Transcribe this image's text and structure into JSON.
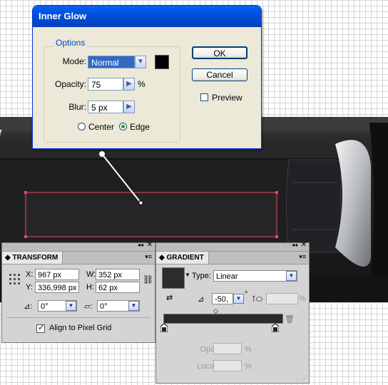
{
  "dialog": {
    "title": "Inner Glow",
    "group_label": "Options",
    "mode_label": "Mode:",
    "mode_value": "Normal",
    "glow_color": "#000000",
    "opacity_label": "Opacity:",
    "opacity_value": "75",
    "opacity_unit": "%",
    "blur_label": "Blur:",
    "blur_value": "5 px",
    "center_label": "Center",
    "edge_label": "Edge",
    "selected_source": "Edge",
    "ok_label": "OK",
    "cancel_label": "Cancel",
    "preview_label": "Preview",
    "preview_checked": false
  },
  "transform": {
    "tab_label": "TRANSFORM",
    "x_label": "X:",
    "x_value": "967 px",
    "y_label": "Y:",
    "y_value": "336,998 px",
    "w_label": "W:",
    "w_value": "352 px",
    "h_label": "H:",
    "h_value": "62 px",
    "rotate_value": "0°",
    "shear_value": "0°",
    "align_label": "Align to Pixel Grid",
    "align_checked": true
  },
  "gradient": {
    "tab_label": "GRADIENT",
    "type_label": "Type:",
    "type_value": "Linear",
    "angle_value": "-50,",
    "angle_unit": "°",
    "aspect_unit": "%",
    "opacity_label": "Opacity:",
    "opacity_unit": "%",
    "location_label": "Location:",
    "location_unit": "%"
  }
}
